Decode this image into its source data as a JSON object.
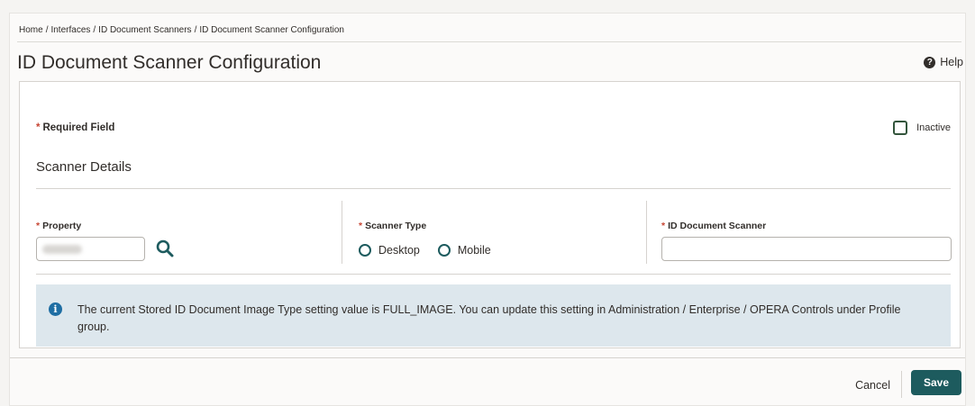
{
  "breadcrumb": [
    "Home",
    "Interfaces",
    "ID Document Scanners",
    "ID Document Scanner Configuration"
  ],
  "breadcrumb_separator": "/",
  "page": {
    "title": "ID Document Scanner Configuration"
  },
  "help": {
    "label": "Help",
    "icon": "help-circle-icon",
    "glyph": "?"
  },
  "form": {
    "required_star": "*",
    "required_note": "Required Field",
    "inactive_label": "Inactive",
    "inactive_checked": false,
    "section_title": "Scanner Details",
    "property": {
      "label": "Property",
      "value": "",
      "search_icon": "search-icon"
    },
    "scanner_type": {
      "label": "Scanner Type",
      "options": [
        "Desktop",
        "Mobile"
      ],
      "selected": null
    },
    "id_document_scanner": {
      "label": "ID Document Scanner",
      "value": "",
      "placeholder": ""
    }
  },
  "info": {
    "icon": "info-icon",
    "glyph": "i",
    "message": "The current Stored ID Document Image Type setting value is FULL_IMAGE. You can update this setting in Administration / Enterprise / OPERA Controls under Profile group."
  },
  "footer": {
    "cancel_label": "Cancel",
    "save_label": "Save"
  },
  "colors": {
    "accent": "#1d5b5e",
    "required": "#c74634",
    "info_bg": "#dde7ed",
    "info_icon": "#1f6ea3"
  }
}
